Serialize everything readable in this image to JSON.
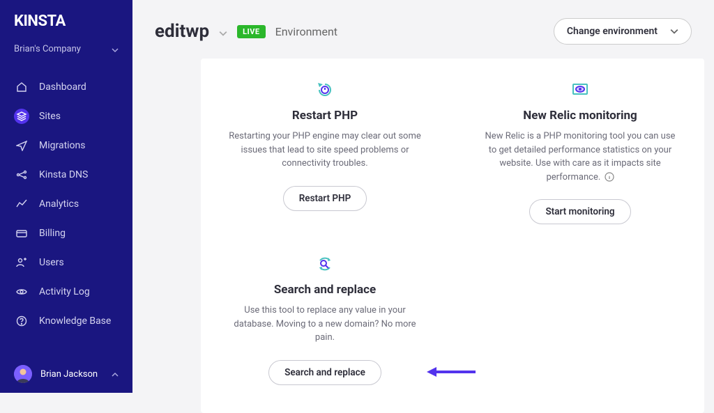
{
  "brand": "KINSTA",
  "company": "Brian's Company",
  "nav": {
    "dashboard": "Dashboard",
    "sites": "Sites",
    "migrations": "Migrations",
    "dns": "Kinsta DNS",
    "analytics": "Analytics",
    "billing": "Billing",
    "users": "Users",
    "activity": "Activity Log",
    "knowledge": "Knowledge Base"
  },
  "user": "Brian Jackson",
  "header": {
    "site": "editwp",
    "env_badge": "LIVE",
    "env_label": "Environment",
    "change_env": "Change environment"
  },
  "cards": {
    "restart": {
      "title": "Restart PHP",
      "desc": "Restarting your PHP engine may clear out some issues that lead to site speed problems or connectivity troubles.",
      "button": "Restart PHP"
    },
    "newrelic": {
      "title": "New Relic monitoring",
      "desc": "New Relic is a PHP monitoring tool you can use to get detailed performance statistics on your website. Use with care as it impacts site performance.",
      "button": "Start monitoring"
    },
    "search": {
      "title": "Search and replace",
      "desc": "Use this tool to replace any value in your database. Moving to a new domain? No more pain.",
      "button": "Search and replace"
    }
  }
}
